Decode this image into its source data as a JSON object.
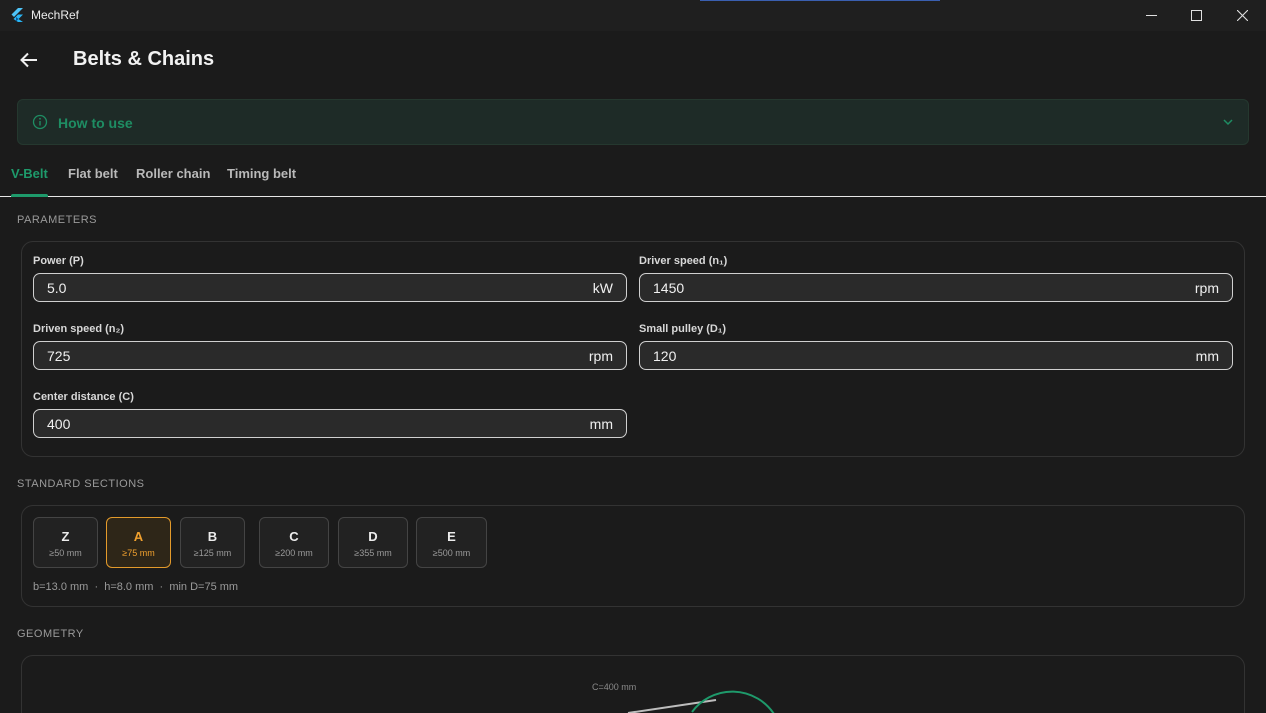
{
  "window": {
    "app_title": "MechRef",
    "icons": {
      "logo": "flutter-logo-icon",
      "minimize": "minimize-icon",
      "maximize": "maximize-icon",
      "close": "close-icon"
    }
  },
  "header": {
    "title": "Belts & Chains",
    "back_icon": "arrow-left-icon"
  },
  "howto": {
    "label": "How to use",
    "icon": "info-icon",
    "chevron": "chevron-down-icon"
  },
  "tabs": [
    {
      "label": "V-Belt",
      "active": true
    },
    {
      "label": "Flat belt",
      "active": false
    },
    {
      "label": "Roller chain",
      "active": false
    },
    {
      "label": "Timing belt",
      "active": false
    }
  ],
  "parameters": {
    "heading": "PARAMETERS",
    "fields": [
      {
        "label": "Power (P)",
        "value": "5.0",
        "unit": "kW"
      },
      {
        "label": "Driver speed (n₁)",
        "value": "1450",
        "unit": "rpm"
      },
      {
        "label": "Driven speed (n₂)",
        "value": "725",
        "unit": "rpm"
      },
      {
        "label": "Small pulley (D₁)",
        "value": "120",
        "unit": "mm"
      },
      {
        "label": "Center distance (C)",
        "value": "400",
        "unit": "mm"
      }
    ]
  },
  "sections": {
    "heading": "STANDARD SECTIONS",
    "items": [
      {
        "label": "Z",
        "sub": "≥50 mm",
        "selected": false
      },
      {
        "label": "A",
        "sub": "≥75 mm",
        "selected": true
      },
      {
        "label": "B",
        "sub": "≥125 mm",
        "selected": false
      },
      {
        "label": "C",
        "sub": "≥200 mm",
        "selected": false
      },
      {
        "label": "D",
        "sub": "≥355 mm",
        "selected": false
      },
      {
        "label": "E",
        "sub": "≥500 mm",
        "selected": false
      }
    ],
    "info": "b=13.0 mm  ·  h=8.0 mm  ·  min D=75 mm",
    "accent": "#f0a02e"
  },
  "geometry": {
    "heading": "GEOMETRY",
    "center_label": "C=400 mm"
  },
  "colors": {
    "accent": "#1e9a6b",
    "selected": "#f0a02e",
    "background": "#1b1b1b"
  }
}
